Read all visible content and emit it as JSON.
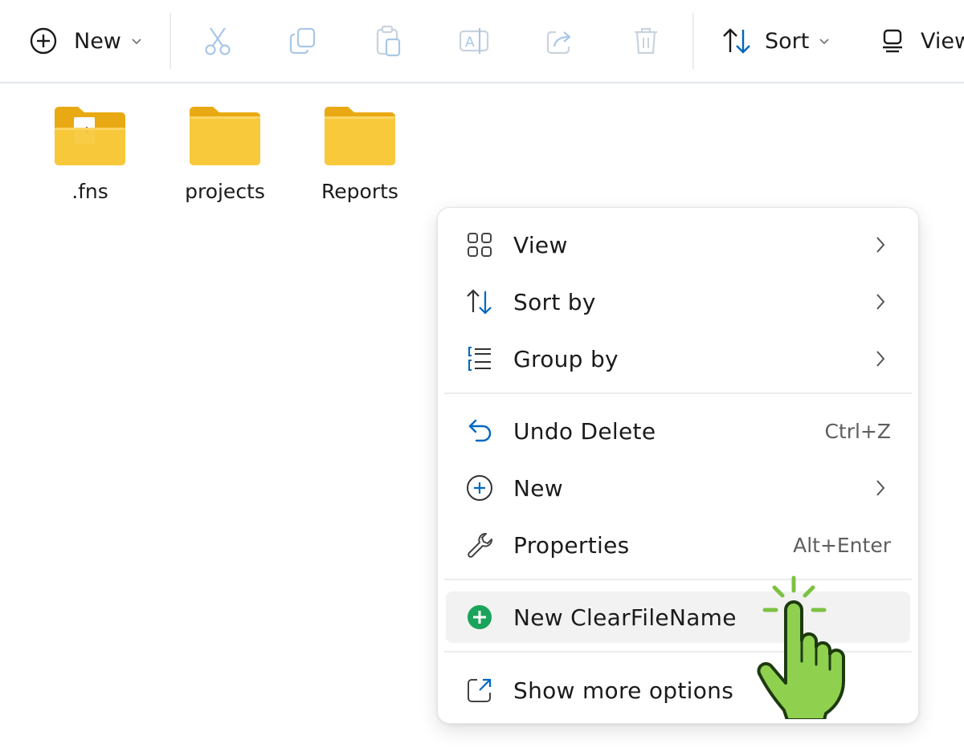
{
  "toolbar": {
    "new_label": "New",
    "sort_label": "Sort",
    "view_label": "View"
  },
  "folders": [
    {
      "name": ".fns"
    },
    {
      "name": "projects"
    },
    {
      "name": "Reports"
    }
  ],
  "context_menu": {
    "view": {
      "label": "View"
    },
    "sort_by": {
      "label": "Sort by"
    },
    "group_by": {
      "label": "Group by"
    },
    "undo_delete": {
      "label": "Undo Delete",
      "shortcut": "Ctrl+Z"
    },
    "new": {
      "label": "New"
    },
    "properties": {
      "label": "Properties",
      "shortcut": "Alt+Enter"
    },
    "new_clearfilename": {
      "label": "New ClearFileName"
    },
    "show_more": {
      "label": "Show more options"
    }
  },
  "colors": {
    "accent_blue": "#0067c0",
    "folder_yellow": "#f8c93b",
    "brand_green": "#1aa35a",
    "cursor_green": "#8fd14f"
  }
}
